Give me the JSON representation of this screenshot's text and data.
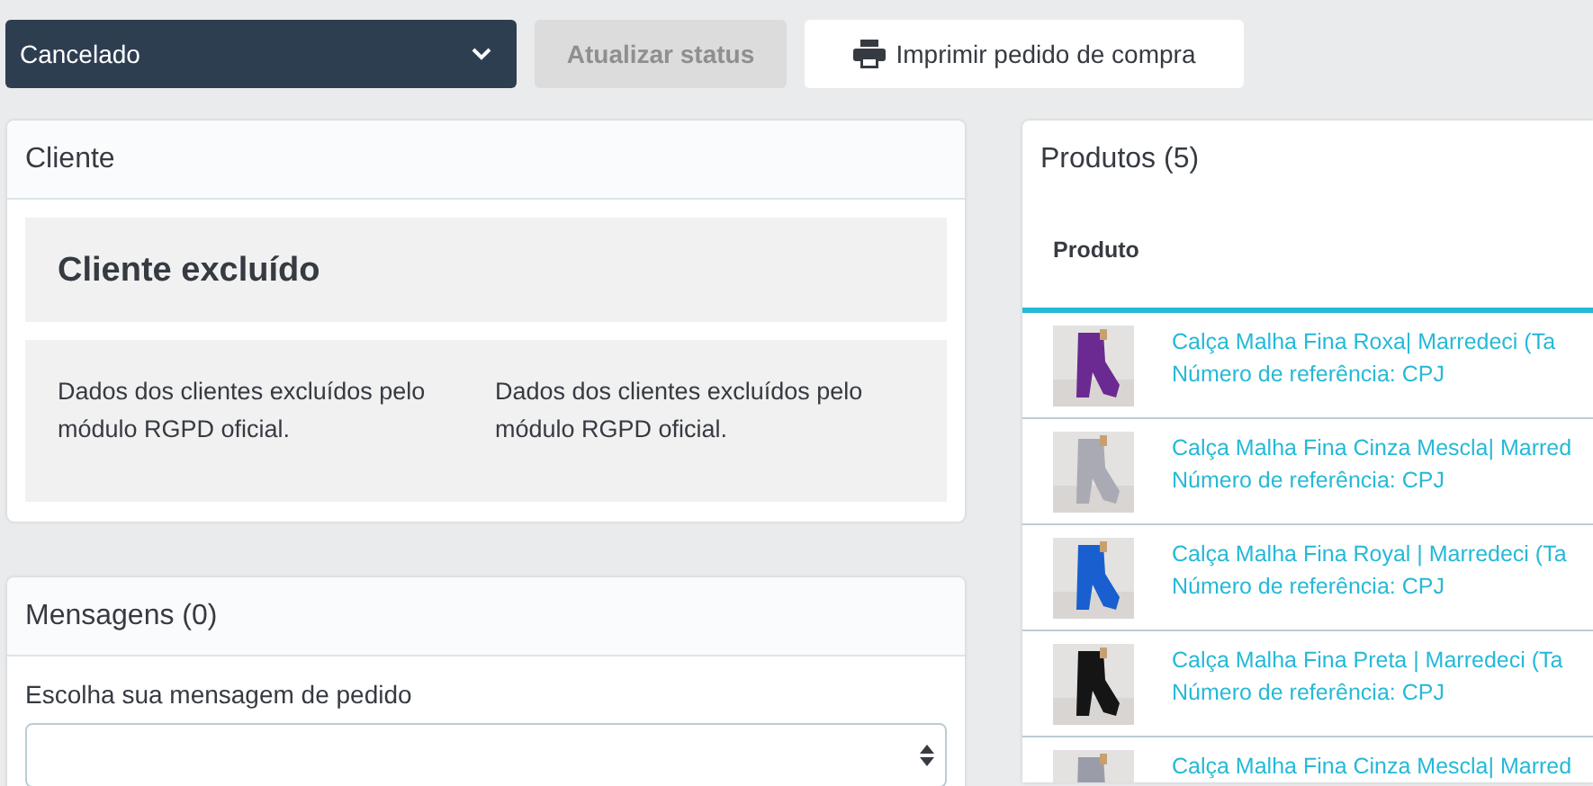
{
  "toolbar": {
    "status_select": {
      "value": "Cancelado"
    },
    "update_button": {
      "label": "Atualizar status",
      "disabled": true
    },
    "print_button": {
      "label": "Imprimir pedido de compra"
    }
  },
  "customer_panel": {
    "title": "Cliente",
    "name": "Cliente excluído",
    "details": [
      "Dados dos clientes excluídos pelo módulo RGPD oficial.",
      "Dados dos clientes excluídos pelo módulo RGPD oficial."
    ]
  },
  "messages_panel": {
    "title": "Mensagens (0)",
    "label": "Escolha sua mensagem de pedido"
  },
  "products_panel": {
    "title": "Produtos (5)",
    "columns": [
      "Produto"
    ],
    "rows": [
      {
        "name": "Calça Malha Fina Roxa| Marredeci (Ta",
        "reference": "Número de referência: CPJ"
      },
      {
        "name": "Calça Malha Fina Cinza Mescla| Marred",
        "reference": "Número de referência: CPJ"
      },
      {
        "name": "Calça Malha Fina Royal | Marredeci (Ta",
        "reference": "Número de referência: CPJ"
      },
      {
        "name": "Calça Malha Fina Preta | Marredeci (Ta",
        "reference": "Número de referência: CPJ"
      },
      {
        "name": "Calça Malha Fina Cinza Mescla| Marred"
      }
    ]
  }
}
